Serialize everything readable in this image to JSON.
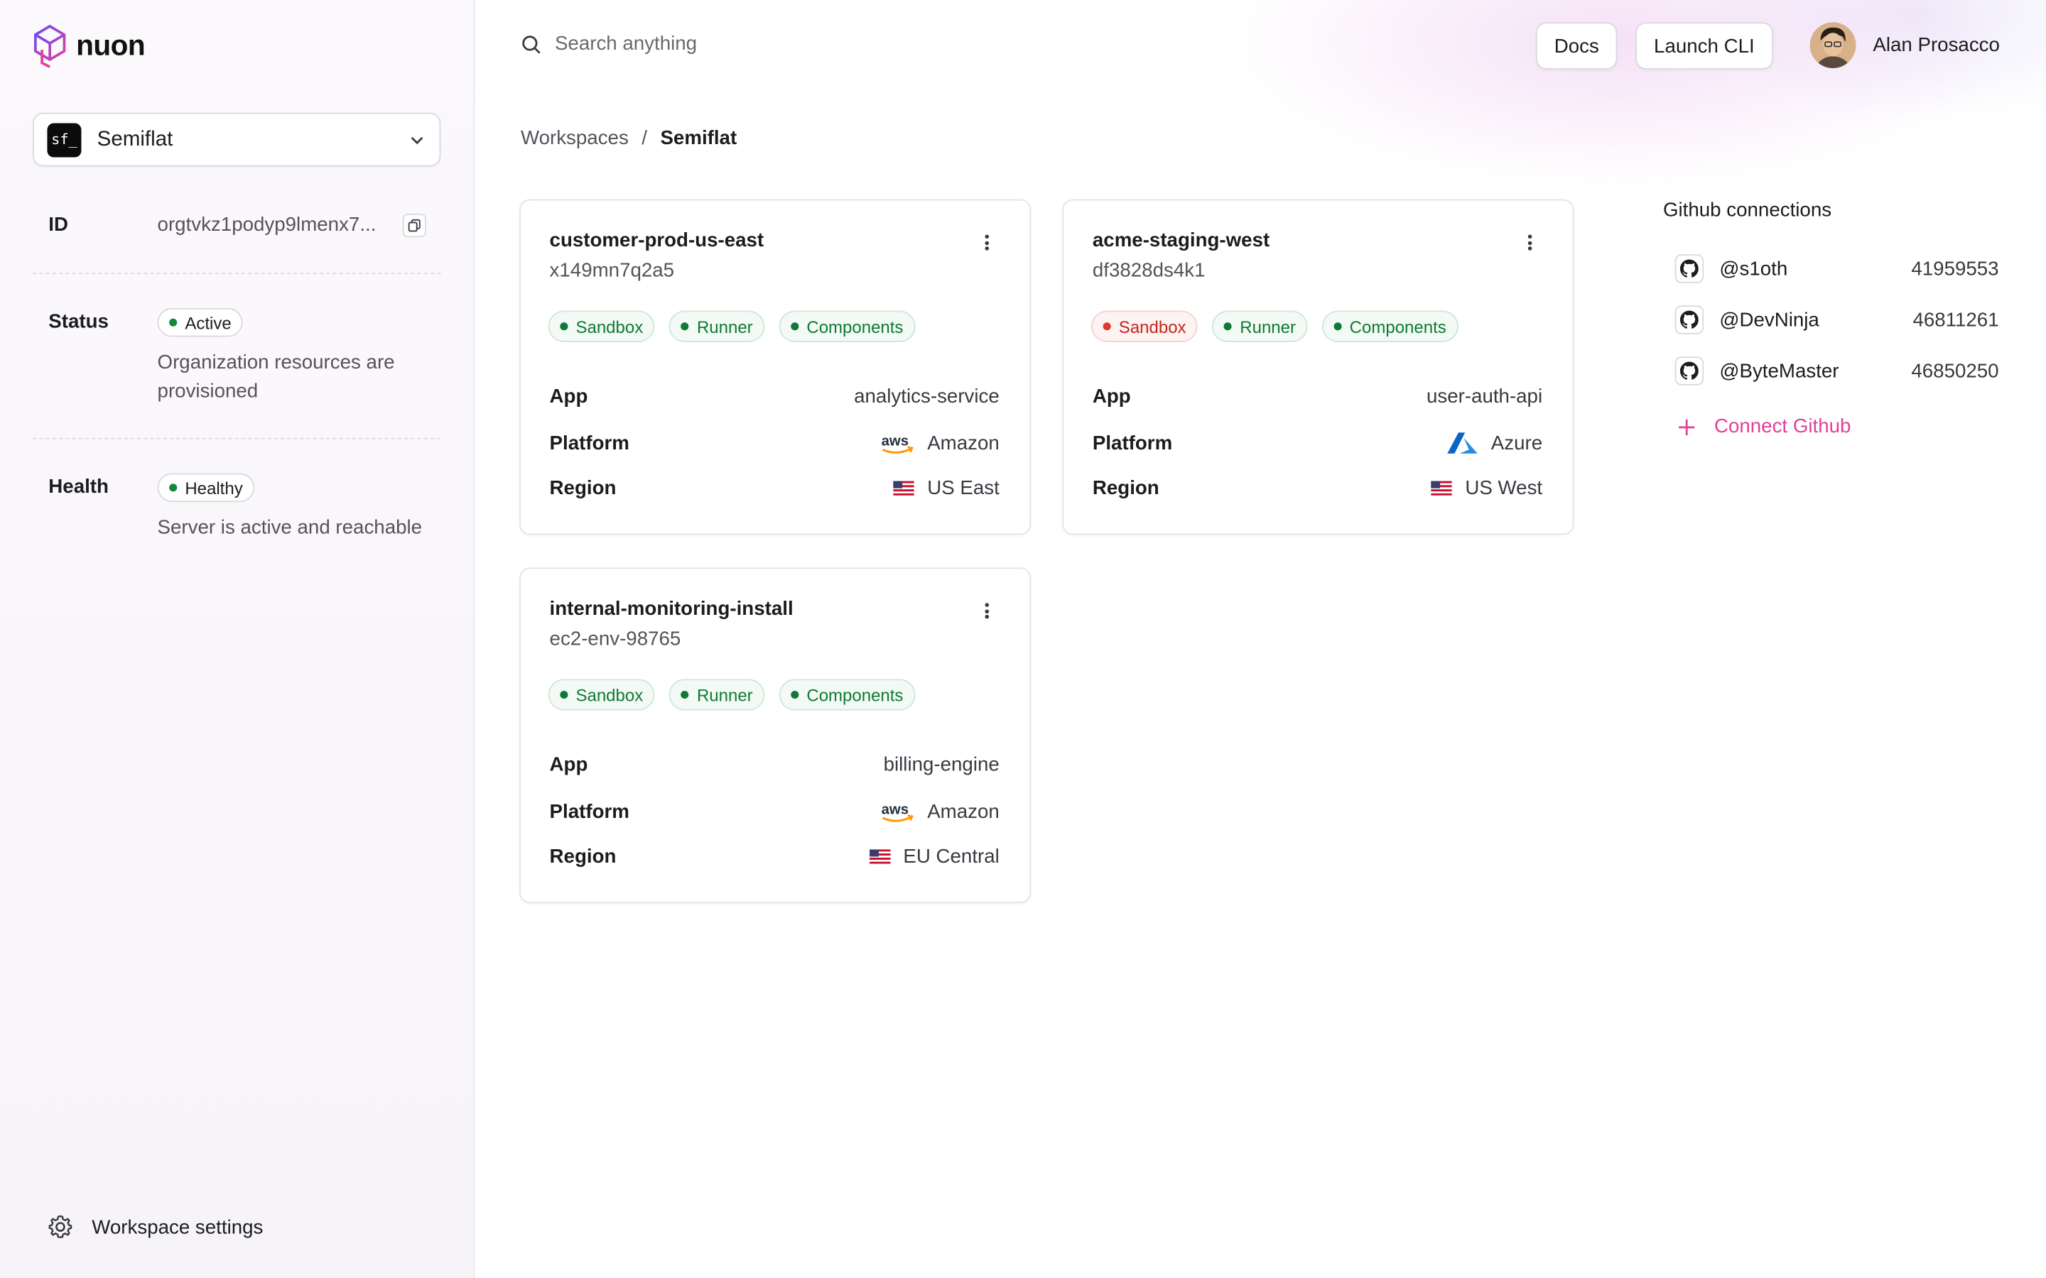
{
  "brand": {
    "name": "nuon"
  },
  "org": {
    "initials": "sf_",
    "name": "Semiflat",
    "id": "orgtvkz1podyp9lmenx7..."
  },
  "status": {
    "label": "Status",
    "badge": "Active",
    "desc": "Organization resources are provisioned"
  },
  "health": {
    "label": "Health",
    "badge": "Healthy",
    "desc": "Server is active and reachable"
  },
  "id_label": "ID",
  "sidebar_footer": {
    "settings_label": "Workspace settings"
  },
  "header": {
    "search_placeholder": "Search anything",
    "docs_label": "Docs",
    "cli_label": "Launch CLI",
    "user_name": "Alan Prosacco"
  },
  "breadcrumb": {
    "root": "Workspaces",
    "sep": "/",
    "current": "Semiflat"
  },
  "labels": {
    "app": "App",
    "platform": "Platform",
    "region": "Region",
    "sandbox": "Sandbox",
    "runner": "Runner",
    "components": "Components"
  },
  "installs": [
    {
      "name": "customer-prod-us-east",
      "id": "x149mn7q2a5",
      "sandbox_status": "ok",
      "app": "analytics-service",
      "platform": "Amazon",
      "platform_icon": "aws-icon",
      "region": "US East"
    },
    {
      "name": "acme-staging-west",
      "id": "df3828ds4k1",
      "sandbox_status": "error",
      "app": "user-auth-api",
      "platform": "Azure",
      "platform_icon": "azure-icon",
      "region": "US West"
    },
    {
      "name": "internal-monitoring-install",
      "id": "ec2-env-98765",
      "sandbox_status": "ok",
      "app": "billing-engine",
      "platform": "Amazon",
      "platform_icon": "aws-icon",
      "region": "EU Central"
    }
  ],
  "github": {
    "title": "Github connections",
    "connections": [
      {
        "user": "@s1oth",
        "id": "41959553"
      },
      {
        "user": "@DevNinja",
        "id": "46811261"
      },
      {
        "user": "@ByteMaster",
        "id": "46850250"
      }
    ],
    "connect_label": "Connect Github"
  },
  "colors": {
    "ok": "#0e7a33",
    "error": "#c3261c",
    "accent": "#e0409a"
  }
}
